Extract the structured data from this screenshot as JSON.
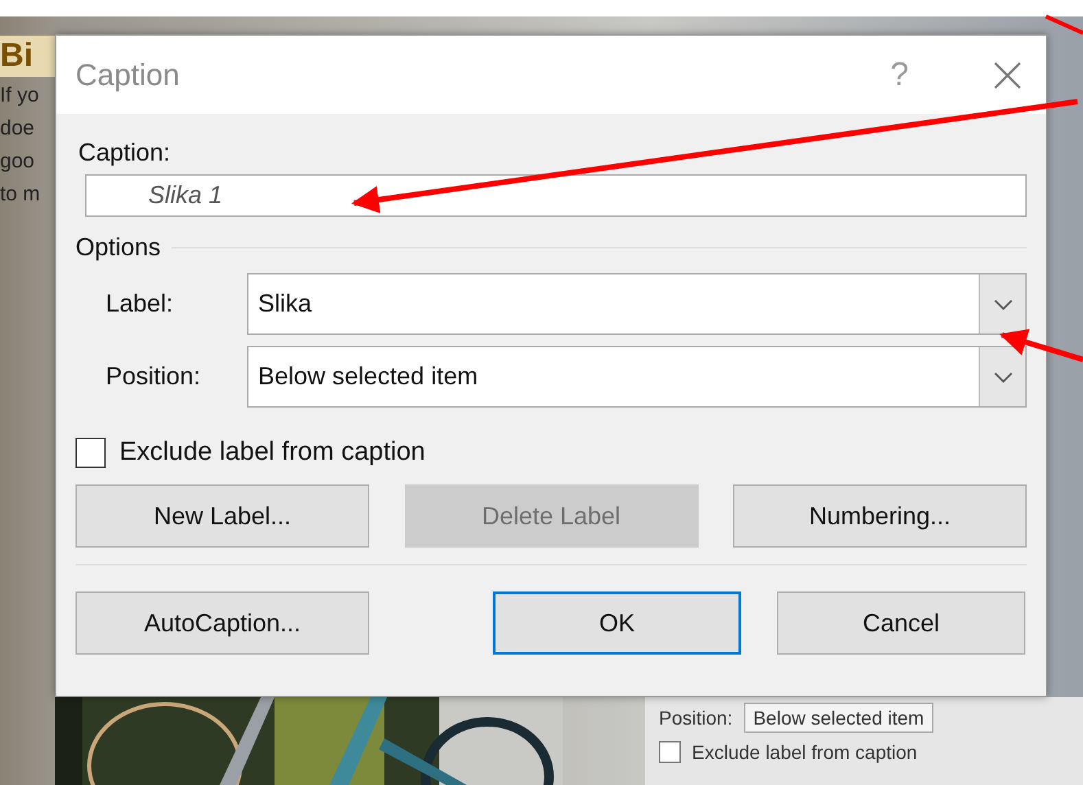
{
  "background": {
    "document_text": [
      "Bi",
      "If yo",
      "doe",
      "goo",
      "to m"
    ],
    "back_dialog": {
      "position_label": "Position:",
      "position_value": "Below selected item",
      "checkbox_label": "Exclude label from caption",
      "checked": false
    }
  },
  "dialog": {
    "title": "Caption",
    "help": "?",
    "caption": {
      "label": "Caption:",
      "value": "Slika 1"
    },
    "options_heading": "Options",
    "combos": [
      {
        "label": "Label:",
        "value": "Slika"
      },
      {
        "label": "Position:",
        "value": "Below selected item"
      }
    ],
    "exclude": {
      "label": "Exclude label from caption",
      "checked": false
    },
    "button_rows": [
      [
        {
          "label": "New Label...",
          "disabled": false,
          "default": false
        },
        {
          "label": "Delete Label",
          "disabled": true,
          "default": false
        },
        {
          "label": "Numbering...",
          "disabled": false,
          "default": false
        }
      ],
      [
        {
          "label": "AutoCaption...",
          "disabled": false,
          "default": false
        },
        {
          "label": "OK",
          "disabled": false,
          "default": true
        },
        {
          "label": "Cancel",
          "disabled": false,
          "default": false
        }
      ]
    ]
  }
}
